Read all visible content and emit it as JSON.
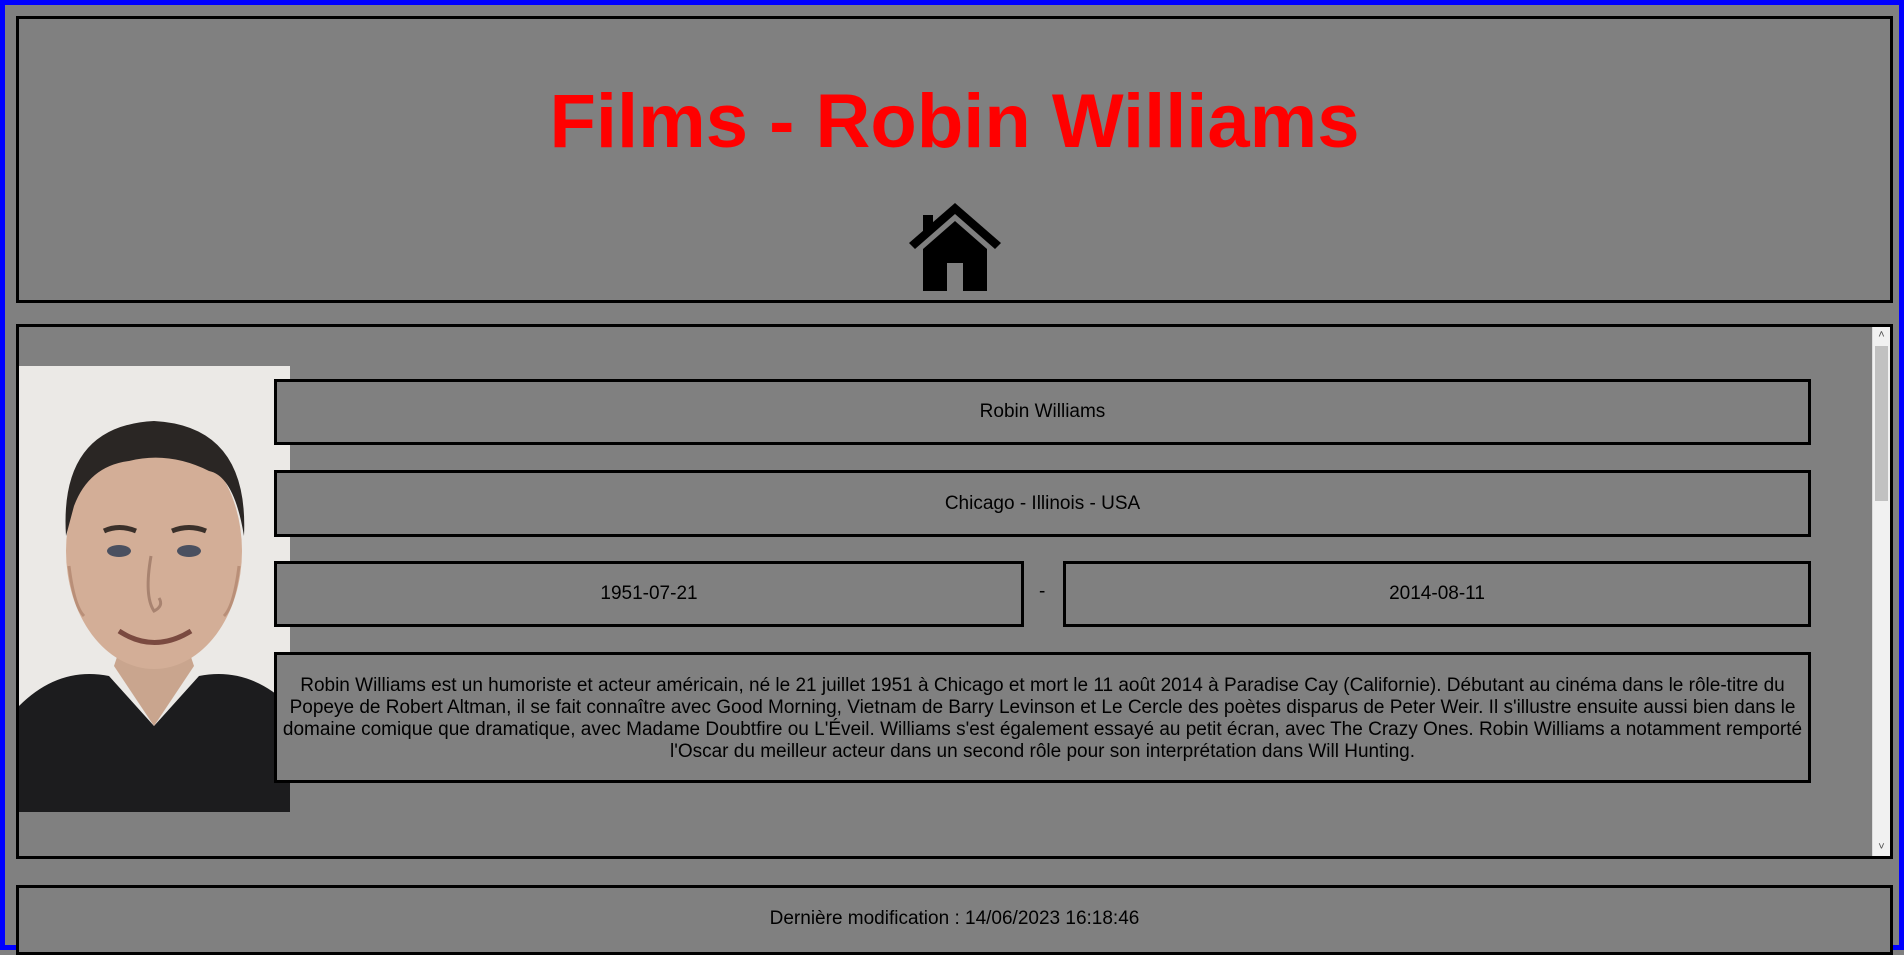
{
  "header": {
    "title": "Films - Robin Williams",
    "home_icon": "home-icon"
  },
  "person": {
    "photo_icon": "portrait-photo",
    "name": "Robin Williams",
    "birthplace": "Chicago - Illinois - USA",
    "birth_date": "1951-07-21",
    "date_separator": "-",
    "death_date": "2014-08-11",
    "biography": "Robin Williams est un humoriste et acteur américain, né le 21 juillet 1951 à Chicago et mort le 11 août 2014 à Paradise Cay (Californie). Débutant au cinéma dans le rôle-titre du Popeye de Robert Altman, il se fait connaître avec Good Morning, Vietnam de Barry Levinson et Le Cercle des poètes disparus de Peter Weir. Il s'illustre ensuite aussi bien dans le domaine comique que dramatique, avec Madame Doubtfire ou L'Éveil. Williams s'est également essayé au petit écran, avec The Crazy Ones. Robin Williams a notamment remporté l'Oscar du meilleur acteur dans un second rôle pour son interprétation dans Will Hunting."
  },
  "scrollbar": {
    "up_arrow": "˄",
    "down_arrow": "˅"
  },
  "footer": {
    "last_modified": "Dernière modification : 14/06/2023 16:18:46"
  },
  "colors": {
    "background": "#808080",
    "title": "#ff0000",
    "page_border": "#0000ff"
  }
}
